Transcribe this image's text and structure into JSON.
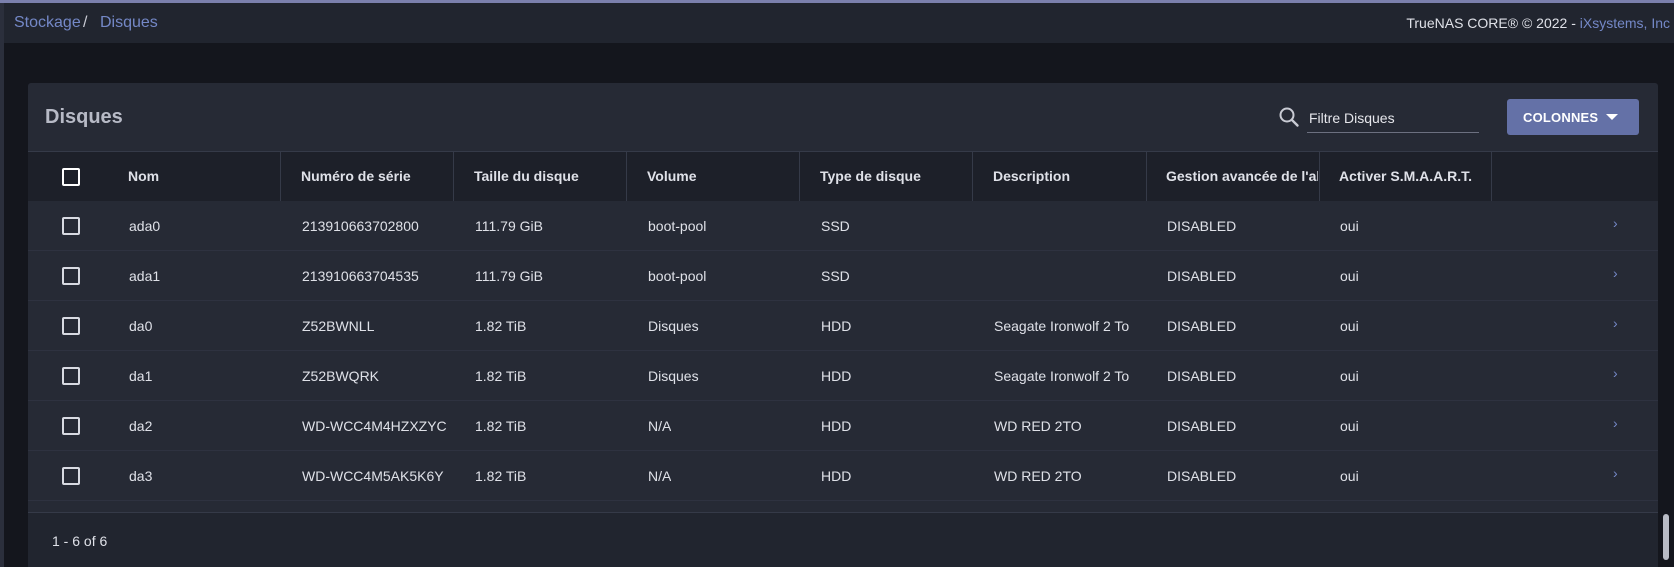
{
  "breadcrumb": {
    "items": [
      "Stockage",
      "Disques"
    ],
    "separator": "/"
  },
  "copyright": {
    "prefix": "TrueNAS CORE® © 2022 - ",
    "company": "iXsystems, Inc"
  },
  "card": {
    "title": "Disques",
    "search": {
      "placeholder": "Filtre Disques",
      "value": "",
      "icon": "search-icon"
    },
    "columns_button": {
      "label": "COLONNES",
      "icon": "caret-down-icon"
    }
  },
  "table": {
    "headers": [
      "Nom",
      "Numéro de série",
      "Taille du disque",
      "Volume",
      "Type de disque",
      "Description",
      "Gestion avancée de l'alimentation",
      "Activer S.M.A.A.R.T."
    ],
    "rows": [
      {
        "name": "ada0",
        "serial": "213910663702800",
        "size": "111.79 GiB",
        "pool": "boot-pool",
        "type": "SSD",
        "description": "",
        "apm": "DISABLED",
        "smart": "oui"
      },
      {
        "name": "ada1",
        "serial": "213910663704535",
        "size": "111.79 GiB",
        "pool": "boot-pool",
        "type": "SSD",
        "description": "",
        "apm": "DISABLED",
        "smart": "oui"
      },
      {
        "name": "da0",
        "serial": "Z52BWNLL",
        "size": "1.82 TiB",
        "pool": "Disques",
        "type": "HDD",
        "description": "Seagate Ironwolf 2 To",
        "apm": "DISABLED",
        "smart": "oui"
      },
      {
        "name": "da1",
        "serial": "Z52BWQRK",
        "size": "1.82 TiB",
        "pool": "Disques",
        "type": "HDD",
        "description": "Seagate Ironwolf 2 To",
        "apm": "DISABLED",
        "smart": "oui"
      },
      {
        "name": "da2",
        "serial": "WD-WCC4M4HZXZYC",
        "size": "1.82 TiB",
        "pool": "N/A",
        "type": "HDD",
        "description": "WD RED 2TO",
        "apm": "DISABLED",
        "smart": "oui"
      },
      {
        "name": "da3",
        "serial": "WD-WCC4M5AK5K6Y",
        "size": "1.82 TiB",
        "pool": "N/A",
        "type": "HDD",
        "description": "WD RED 2TO",
        "apm": "DISABLED",
        "smart": "oui"
      }
    ],
    "row_action_icon": "chevron-right-icon"
  },
  "pager": {
    "text": "1 - 6 of 6"
  },
  "colors": {
    "accent": "#7488c7",
    "button": "#6471a7",
    "background": "#14161d",
    "card": "#262a35",
    "header": "#1d2029"
  }
}
